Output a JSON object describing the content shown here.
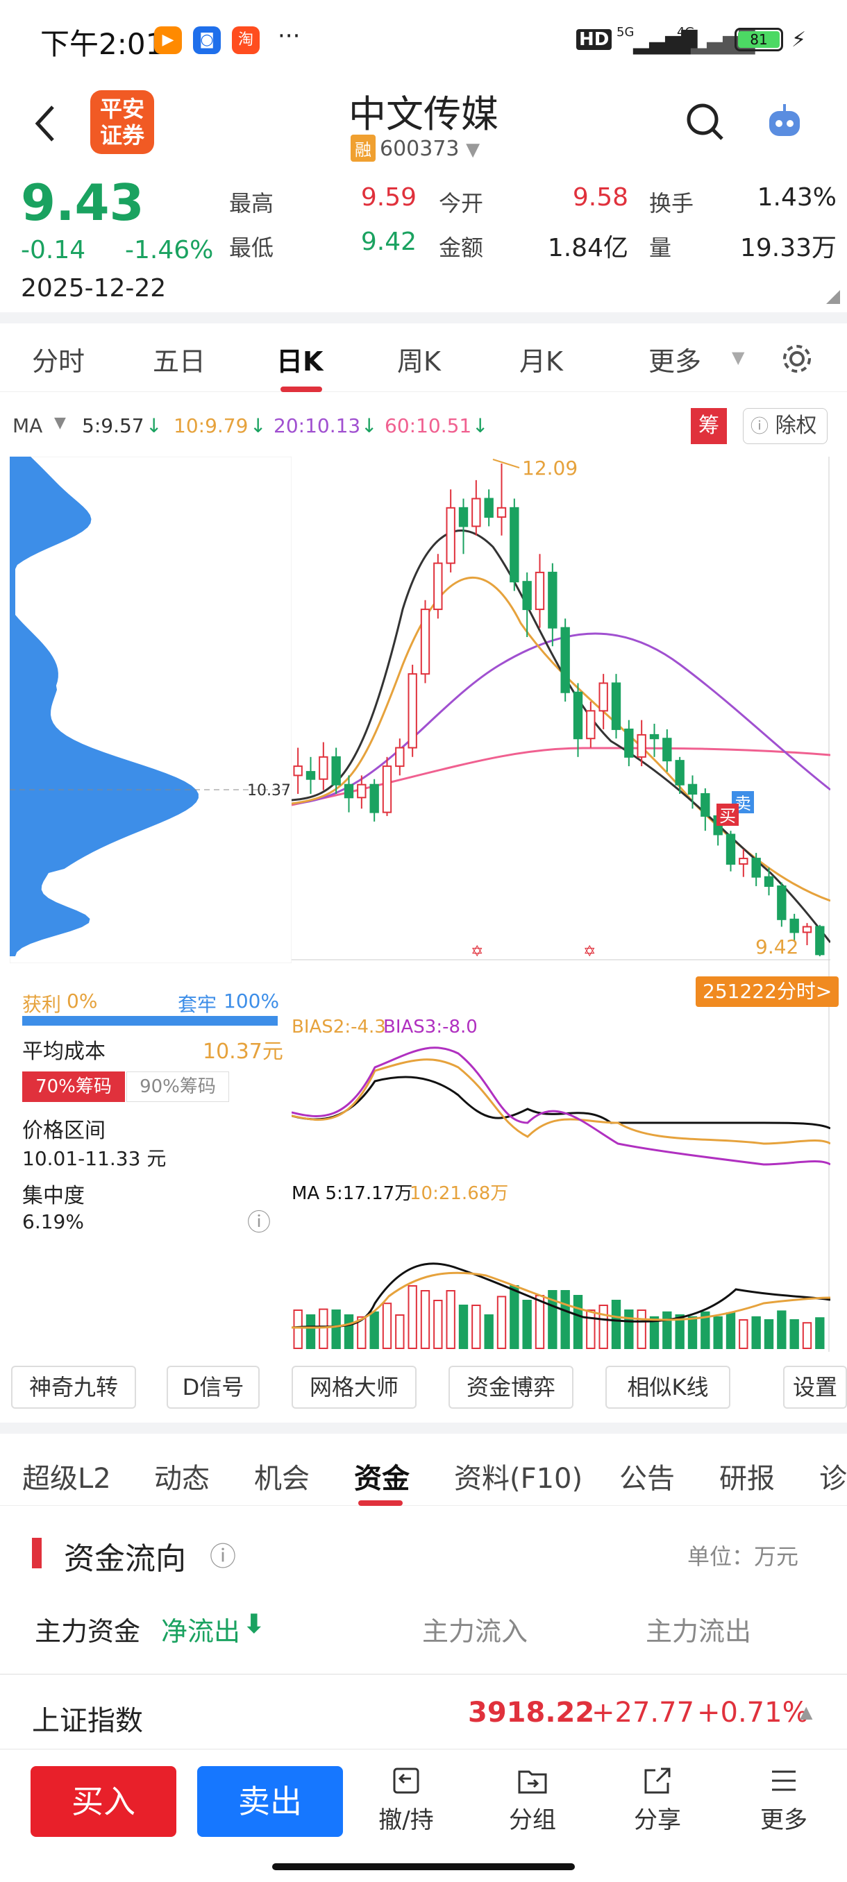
{
  "status_bar": {
    "time": "下午2:01",
    "more": "···",
    "net1": "5G",
    "net2": "4G",
    "hd": "HD",
    "battery": "81"
  },
  "header": {
    "logo_text": "平安证券",
    "stock_name": "中文传媒",
    "rong_badge": "融",
    "stock_code": "600373"
  },
  "quote": {
    "price": "9.43",
    "change": "-0.14",
    "change_pct": "-1.46%",
    "date": "2025-12-22",
    "high_label": "最高",
    "high": "9.59",
    "open_label": "今开",
    "open": "9.58",
    "turnover_label": "换手",
    "turnover": "1.43%",
    "low_label": "最低",
    "low": "9.42",
    "amount_label": "金额",
    "amount": "1.84亿",
    "volume_label": "量",
    "volume": "19.33万"
  },
  "period_tabs": [
    "分时",
    "五日",
    "日K",
    "周K",
    "月K",
    "更多"
  ],
  "ma_line": {
    "label": "MA",
    "ma5": "5:9.57",
    "ma10": "10:9.79",
    "ma20": "20:10.13",
    "ma60": "60:10.51",
    "chou": "筹",
    "chuquan": "除权"
  },
  "chart_labels": {
    "high_mark": "12.09",
    "low_mark": "9.42",
    "avg_line": "10.37",
    "fenshi_btn": "251222分时>",
    "buy_mark": "买",
    "sell_mark": "卖",
    "bias": "BIAS2:-4.3",
    "bias3": "BIAS3:-8.0",
    "vol_ma5": "MA 5:17.17万",
    "vol_ma10": "10:21.68万"
  },
  "chips": {
    "profit_label": "获利",
    "profit": "0%",
    "trapped_label": "套牢",
    "trapped": "100%",
    "avg_cost_label": "平均成本",
    "avg_cost": "10.37元",
    "tab70": "70%筹码",
    "tab90": "90%筹码",
    "range_label": "价格区间",
    "range": "10.01-11.33 元",
    "conc_label": "集中度",
    "conc": "6.19%"
  },
  "tools": [
    "神奇九转",
    "D信号",
    "网格大师",
    "资金博弈",
    "相似K线",
    "设置"
  ],
  "sub_tabs": [
    "超级L2",
    "动态",
    "机会",
    "资金",
    "资料(F10)",
    "公告",
    "研报",
    "诊"
  ],
  "flow": {
    "title": "资金流向",
    "unit": "单位：万元",
    "main_label": "主力资金",
    "net_out": "净流出",
    "in_label": "主力流入",
    "out_label": "主力流出"
  },
  "index_bar": {
    "name": "上证指数",
    "value": "3918.22",
    "change": "+27.77",
    "pct": "+0.71%"
  },
  "bottom": {
    "buy": "买入",
    "sell": "卖出",
    "cancel": "撤/持",
    "group": "分组",
    "share": "分享",
    "more": "更多"
  },
  "colors": {
    "up": "#e0313c",
    "down": "#1aa260",
    "accent": "#e0313c",
    "sell_btn": "#1677ff",
    "buy_btn": "#e8202a"
  },
  "chart_data": {
    "type": "candlestick",
    "title": "",
    "price_range": [
      9.42,
      12.09
    ],
    "candles": [
      {
        "o": 10.4,
        "c": 10.45,
        "h": 10.55,
        "l": 10.3
      },
      {
        "o": 10.42,
        "c": 10.38,
        "h": 10.5,
        "l": 10.3
      },
      {
        "o": 10.38,
        "c": 10.5,
        "h": 10.58,
        "l": 10.32
      },
      {
        "o": 10.5,
        "c": 10.35,
        "h": 10.55,
        "l": 10.3
      },
      {
        "o": 10.35,
        "c": 10.28,
        "h": 10.4,
        "l": 10.2
      },
      {
        "o": 10.28,
        "c": 10.35,
        "h": 10.4,
        "l": 10.22
      },
      {
        "o": 10.35,
        "c": 10.2,
        "h": 10.38,
        "l": 10.15
      },
      {
        "o": 10.2,
        "c": 10.45,
        "h": 10.5,
        "l": 10.18
      },
      {
        "o": 10.45,
        "c": 10.55,
        "h": 10.6,
        "l": 10.4
      },
      {
        "o": 10.55,
        "c": 10.95,
        "h": 11.0,
        "l": 10.5
      },
      {
        "o": 10.95,
        "c": 11.3,
        "h": 11.35,
        "l": 10.9
      },
      {
        "o": 11.3,
        "c": 11.55,
        "h": 11.6,
        "l": 11.25
      },
      {
        "o": 11.55,
        "c": 11.85,
        "h": 11.95,
        "l": 11.5
      },
      {
        "o": 11.85,
        "c": 11.75,
        "h": 11.9,
        "l": 11.6
      },
      {
        "o": 11.75,
        "c": 11.9,
        "h": 12.0,
        "l": 11.7
      },
      {
        "o": 11.9,
        "c": 11.8,
        "h": 11.95,
        "l": 11.75
      },
      {
        "o": 11.8,
        "c": 11.85,
        "h": 12.09,
        "l": 11.7
      },
      {
        "o": 11.85,
        "c": 11.45,
        "h": 11.9,
        "l": 11.4
      },
      {
        "o": 11.45,
        "c": 11.3,
        "h": 11.5,
        "l": 11.15
      },
      {
        "o": 11.3,
        "c": 11.5,
        "h": 11.6,
        "l": 11.2
      },
      {
        "o": 11.5,
        "c": 11.2,
        "h": 11.55,
        "l": 11.1
      },
      {
        "o": 11.2,
        "c": 10.85,
        "h": 11.25,
        "l": 10.8
      },
      {
        "o": 10.85,
        "c": 10.6,
        "h": 10.9,
        "l": 10.5
      },
      {
        "o": 10.6,
        "c": 10.75,
        "h": 10.8,
        "l": 10.55
      },
      {
        "o": 10.75,
        "c": 10.9,
        "h": 10.95,
        "l": 10.65
      },
      {
        "o": 10.9,
        "c": 10.65,
        "h": 10.95,
        "l": 10.6
      },
      {
        "o": 10.65,
        "c": 10.5,
        "h": 10.7,
        "l": 10.45
      },
      {
        "o": 10.5,
        "c": 10.62,
        "h": 10.7,
        "l": 10.45
      },
      {
        "o": 10.62,
        "c": 10.6,
        "h": 10.68,
        "l": 10.5
      },
      {
        "o": 10.6,
        "c": 10.48,
        "h": 10.65,
        "l": 10.42
      },
      {
        "o": 10.48,
        "c": 10.35,
        "h": 10.5,
        "l": 10.3
      },
      {
        "o": 10.35,
        "c": 10.3,
        "h": 10.4,
        "l": 10.22
      },
      {
        "o": 10.3,
        "c": 10.18,
        "h": 10.33,
        "l": 10.1
      },
      {
        "o": 10.18,
        "c": 10.08,
        "h": 10.2,
        "l": 10.02
      },
      {
        "o": 10.08,
        "c": 9.92,
        "h": 10.1,
        "l": 9.88
      },
      {
        "o": 9.92,
        "c": 9.95,
        "h": 10.0,
        "l": 9.85
      },
      {
        "o": 9.95,
        "c": 9.85,
        "h": 9.98,
        "l": 9.8
      },
      {
        "o": 9.85,
        "c": 9.8,
        "h": 9.9,
        "l": 9.75
      },
      {
        "o": 9.8,
        "c": 9.62,
        "h": 9.82,
        "l": 9.58
      },
      {
        "o": 9.62,
        "c": 9.55,
        "h": 9.65,
        "l": 9.5
      },
      {
        "o": 9.55,
        "c": 9.58,
        "h": 9.6,
        "l": 9.48
      },
      {
        "o": 9.58,
        "c": 9.43,
        "h": 9.59,
        "l": 9.42
      }
    ]
  }
}
